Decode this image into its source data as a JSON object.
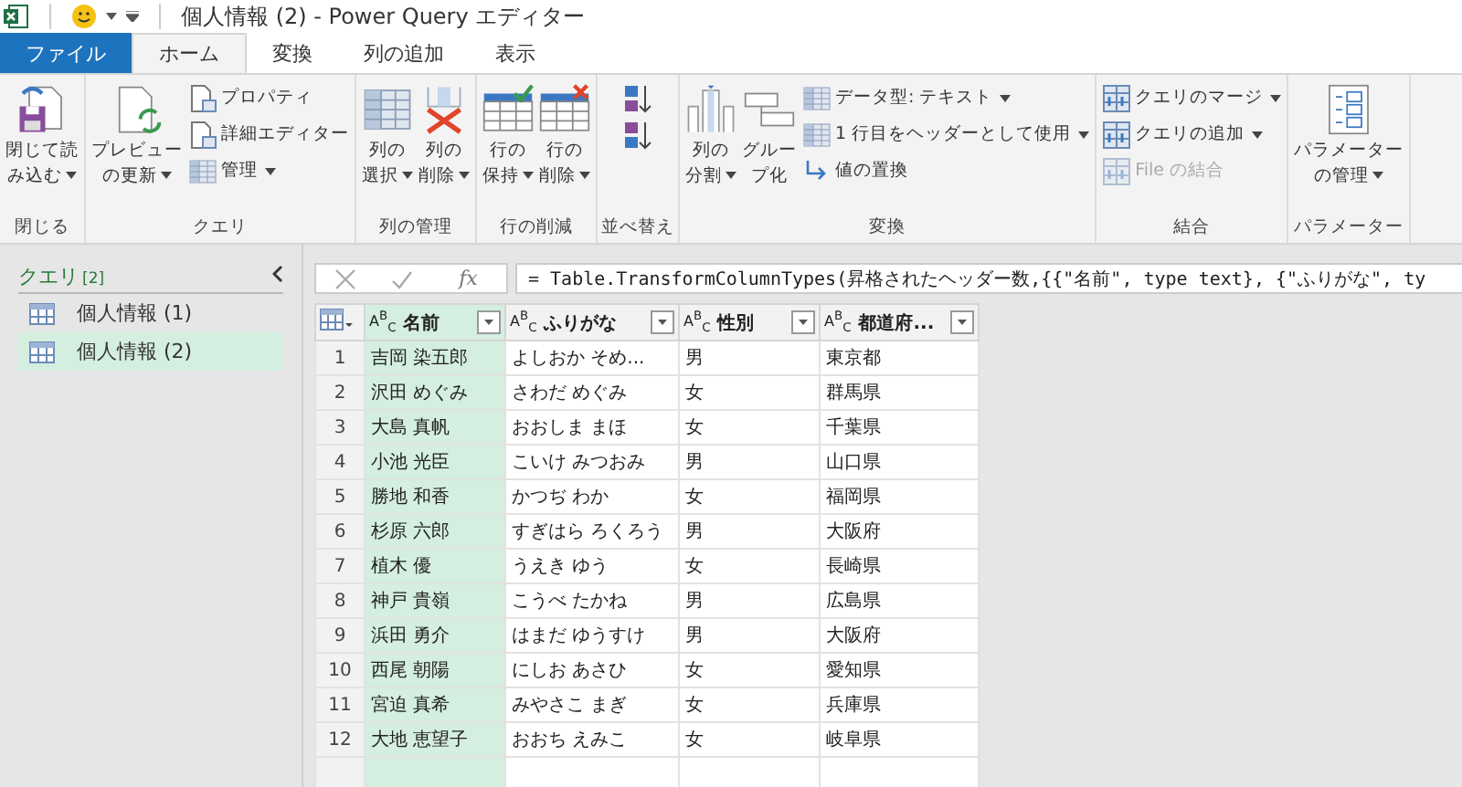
{
  "title_bar": {
    "title": "個人情報 (2) - Power Query エディター"
  },
  "tabs": [
    {
      "label": "ファイル",
      "kind": "file",
      "selected": false
    },
    {
      "label": "ホーム",
      "kind": "tab",
      "selected": true
    },
    {
      "label": "変換",
      "kind": "tab",
      "selected": false
    },
    {
      "label": "列の追加",
      "kind": "tab",
      "selected": false
    },
    {
      "label": "表示",
      "kind": "tab",
      "selected": false
    }
  ],
  "ribbon": [
    {
      "label": "閉じる",
      "items": [
        {
          "kind": "large",
          "lines": [
            "閉じて読",
            "み込む"
          ],
          "dropdown": true
        }
      ]
    },
    {
      "label": "クエリ",
      "items": [
        {
          "kind": "large",
          "lines": [
            "プレビュー",
            "の更新"
          ],
          "dropdown": true
        },
        {
          "kind": "stack",
          "items": [
            {
              "label": "プロパティ",
              "dropdown": false,
              "disabled": false
            },
            {
              "label": "詳細エディター",
              "dropdown": false,
              "disabled": false
            },
            {
              "label": "管理",
              "dropdown": true,
              "disabled": false
            }
          ]
        }
      ]
    },
    {
      "label": "列の管理",
      "items": [
        {
          "kind": "large",
          "lines": [
            "列の",
            "選択"
          ],
          "dropdown": true
        },
        {
          "kind": "large",
          "lines": [
            "列の",
            "削除"
          ],
          "dropdown": true
        }
      ]
    },
    {
      "label": "行の削減",
      "items": [
        {
          "kind": "large",
          "lines": [
            "行の",
            "保持"
          ],
          "dropdown": true
        },
        {
          "kind": "large",
          "lines": [
            "行の",
            "削除"
          ],
          "dropdown": true
        }
      ]
    },
    {
      "label": "並べ替え",
      "items": [
        {
          "kind": "stack",
          "items": [
            {
              "dropdown": false,
              "disabled": false
            },
            {
              "dropdown": false,
              "disabled": false
            }
          ]
        }
      ]
    },
    {
      "label": "変換",
      "items": [
        {
          "kind": "large",
          "lines": [
            "列の",
            "分割"
          ],
          "dropdown": true
        },
        {
          "kind": "large",
          "lines": [
            "グルー",
            "プ化"
          ],
          "dropdown": false
        },
        {
          "kind": "stack",
          "items": [
            {
              "label": "データ型: テキスト",
              "dropdown": true,
              "disabled": false
            },
            {
              "label": "1 行目をヘッダーとして使用",
              "dropdown": true,
              "disabled": false
            },
            {
              "label": "値の置換",
              "dropdown": false,
              "disabled": false
            }
          ]
        }
      ]
    },
    {
      "label": "結合",
      "items": [
        {
          "kind": "stack",
          "items": [
            {
              "label": "クエリのマージ",
              "dropdown": true,
              "disabled": false
            },
            {
              "label": "クエリの追加",
              "dropdown": true,
              "disabled": false
            },
            {
              "label": "File の結合",
              "dropdown": false,
              "disabled": true
            }
          ]
        }
      ]
    },
    {
      "label": "パラメーター",
      "items": [
        {
          "kind": "large",
          "lines": [
            "パラメーター",
            "の管理"
          ],
          "dropdown": true
        }
      ]
    }
  ],
  "queries": {
    "title": "クエリ",
    "count": "[2]",
    "items": [
      {
        "name": "個人情報 (1)",
        "selected": false
      },
      {
        "name": "個人情報 (2)",
        "selected": true
      }
    ]
  },
  "formula_bar": {
    "fx": "fx",
    "formula": "= Table.TransformColumnTypes(昇格されたヘッダー数,{{\"名前\", type text}, {\"ふりがな\", ty"
  },
  "table": {
    "columns": [
      {
        "name": "名前",
        "type": "A$^{B}$$_{C}$",
        "selected": true
      },
      {
        "name": "ふりがな",
        "type": "A$^{B}$$_{C}$",
        "selected": false
      },
      {
        "name": "性別",
        "type": "A$^{B}$$_{C}$",
        "selected": false
      },
      {
        "name": "都道府...",
        "type": "A$^{B}$$_{C}$",
        "selected": false
      }
    ],
    "rows": [
      {
        "number": "1",
        "cells": [
          "吉岡 染五郎",
          "よしおか そめ...",
          "男",
          "東京都"
        ]
      },
      {
        "number": "2",
        "cells": [
          "沢田 めぐみ",
          "さわだ めぐみ",
          "女",
          "群馬県"
        ]
      },
      {
        "number": "3",
        "cells": [
          "大島 真帆",
          "おおしま まほ",
          "女",
          "千葉県"
        ]
      },
      {
        "number": "4",
        "cells": [
          "小池 光臣",
          "こいけ みつおみ",
          "男",
          "山口県"
        ]
      },
      {
        "number": "5",
        "cells": [
          "勝地 和香",
          "かつぢ わか",
          "女",
          "福岡県"
        ]
      },
      {
        "number": "6",
        "cells": [
          "杉原 六郎",
          "すぎはら ろくろう",
          "男",
          "大阪府"
        ]
      },
      {
        "number": "7",
        "cells": [
          "植木 優",
          "うえき ゆう",
          "女",
          "長崎県"
        ]
      },
      {
        "number": "8",
        "cells": [
          "神戸 貴嶺",
          "こうべ たかね",
          "男",
          "広島県"
        ]
      },
      {
        "number": "9",
        "cells": [
          "浜田 勇介",
          "はまだ ゆうすけ",
          "男",
          "大阪府"
        ]
      },
      {
        "number": "10",
        "cells": [
          "西尾 朝陽",
          "にしお あさひ",
          "女",
          "愛知県"
        ]
      },
      {
        "number": "11",
        "cells": [
          "宮迫 真希",
          "みやさこ まぎ",
          "女",
          "兵庫県"
        ]
      },
      {
        "number": "12",
        "cells": [
          "大地 恵望子",
          "おおち えみこ",
          "女",
          "岐阜県"
        ]
      }
    ]
  }
}
